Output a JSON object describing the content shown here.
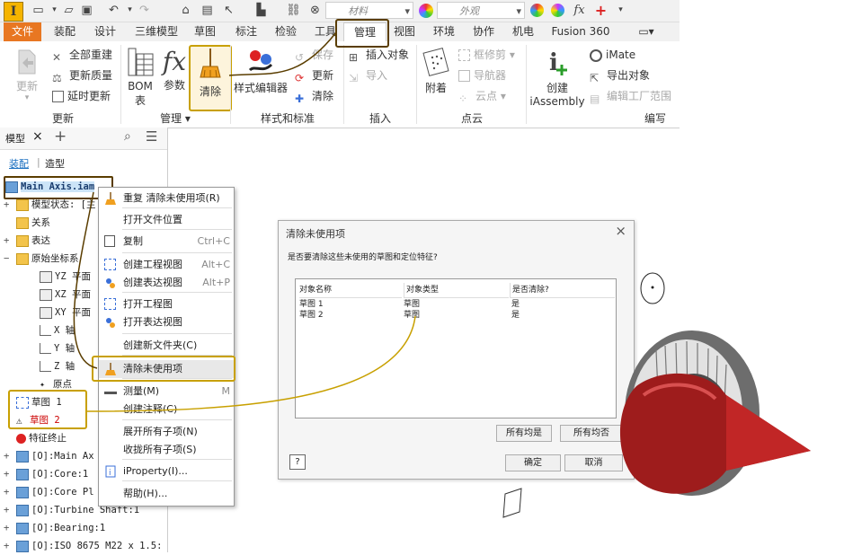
{
  "qat": {
    "material_placeholder": "材料",
    "appearance_placeholder": "外观",
    "fx_label": "fx"
  },
  "tabs": [
    "文件",
    "装配",
    "设计",
    "三维模型",
    "草图",
    "标注",
    "检验",
    "工具",
    "管理",
    "视图",
    "环境",
    "协作",
    "机电",
    "Fusion 360"
  ],
  "ribbon": {
    "update_label": "更新",
    "rebuild_all": "全部重建",
    "update_mass": "更新质量",
    "defer_update": "延时更新",
    "update_group": "更新",
    "bom_label": "BOM",
    "bom_label2": "表",
    "params_label": "参数",
    "purge_label": "清除",
    "manage_group": "管理",
    "style_editor": "样式编辑器",
    "save_label": "保存",
    "update2_label": "更新",
    "purge2_label": "清除",
    "styles_group": "样式和标准",
    "insert_object": "插入对象",
    "import_label": "导入",
    "insert_group": "插入",
    "attach_label": "附着",
    "frame_trim": "框修剪",
    "navigator": "导航器",
    "point_cloud": "云点",
    "pointcloud_group": "点云",
    "create_label": "创建",
    "iassembly_label": "iAssembly",
    "imate_label": "iMate",
    "export_object": "导出对象",
    "edit_factory": "编辑工厂范围",
    "author_group": "编写"
  },
  "browser": {
    "title": "模型",
    "tab_assembly": "装配",
    "tab_modeling": "造型",
    "root": "Main Axis.iam",
    "items": [
      {
        "expand": "+",
        "label": "模型状态: [主"
      },
      {
        "expand": "",
        "label": "关系"
      },
      {
        "expand": "+",
        "label": "表达"
      },
      {
        "expand": "−",
        "label": "原始坐标系"
      },
      {
        "expand": "",
        "label": "YZ 平面"
      },
      {
        "expand": "",
        "label": "XZ 平面"
      },
      {
        "expand": "",
        "label": "XY 平面"
      },
      {
        "expand": "",
        "label": "X 轴"
      },
      {
        "expand": "",
        "label": "Y 轴"
      },
      {
        "expand": "",
        "label": "Z 轴"
      },
      {
        "expand": "",
        "label": "原点"
      },
      {
        "expand": "",
        "label": "草图 1"
      },
      {
        "expand": "",
        "label": "草图 2"
      },
      {
        "expand": "",
        "label": "特征终止"
      },
      {
        "expand": "+",
        "label": "[O]:Main Ax"
      },
      {
        "expand": "+",
        "label": "[O]:Core:1"
      },
      {
        "expand": "+",
        "label": "[O]:Core Pl"
      },
      {
        "expand": "+",
        "label": "[O]:Turbine Shaft:1"
      },
      {
        "expand": "+",
        "label": "[O]:Bearing:1"
      },
      {
        "expand": "+",
        "label": "[O]:ISO 8675 M22 x 1.5:"
      }
    ]
  },
  "context_menu": {
    "items": [
      {
        "label": "重复 清除未使用项(R)",
        "shortcut": ""
      },
      {
        "label": "打开文件位置",
        "shortcut": ""
      },
      {
        "label": "复制",
        "shortcut": "Ctrl+C"
      },
      {
        "label": "创建工程视图",
        "shortcut": "Alt+C"
      },
      {
        "label": "创建表达视图",
        "shortcut": "Alt+P"
      },
      {
        "label": "打开工程图",
        "shortcut": ""
      },
      {
        "label": "打开表达视图",
        "shortcut": ""
      },
      {
        "label": "创建新文件夹(C)",
        "shortcut": ""
      },
      {
        "label": "清除未使用项",
        "shortcut": ""
      },
      {
        "label": "测量(M)",
        "shortcut": "M"
      },
      {
        "label": "创建注释(C)",
        "shortcut": ""
      },
      {
        "label": "展开所有子项(N)",
        "shortcut": ""
      },
      {
        "label": "收拢所有子项(S)",
        "shortcut": ""
      },
      {
        "label": "iProperty(I)...",
        "shortcut": ""
      },
      {
        "label": "帮助(H)...",
        "shortcut": ""
      }
    ]
  },
  "dialog": {
    "title": "清除未使用项",
    "close": "×",
    "question": "是否要清除这些未使用的草图和定位特征?",
    "columns": [
      "对象名称",
      "对象类型",
      "是否清除?"
    ],
    "rows": [
      {
        "name": "草图 1",
        "type": "草图",
        "purge": "是"
      },
      {
        "name": "草图 2",
        "type": "草图",
        "purge": "是"
      }
    ],
    "all_yes": "所有均是",
    "all_no": "所有均否",
    "ok": "确定",
    "cancel": "取消",
    "help": "?"
  },
  "colors": {
    "accent_orange": "#e87722",
    "highlight_gold": "#c8a000",
    "selection_blue": "#cce4f7"
  }
}
